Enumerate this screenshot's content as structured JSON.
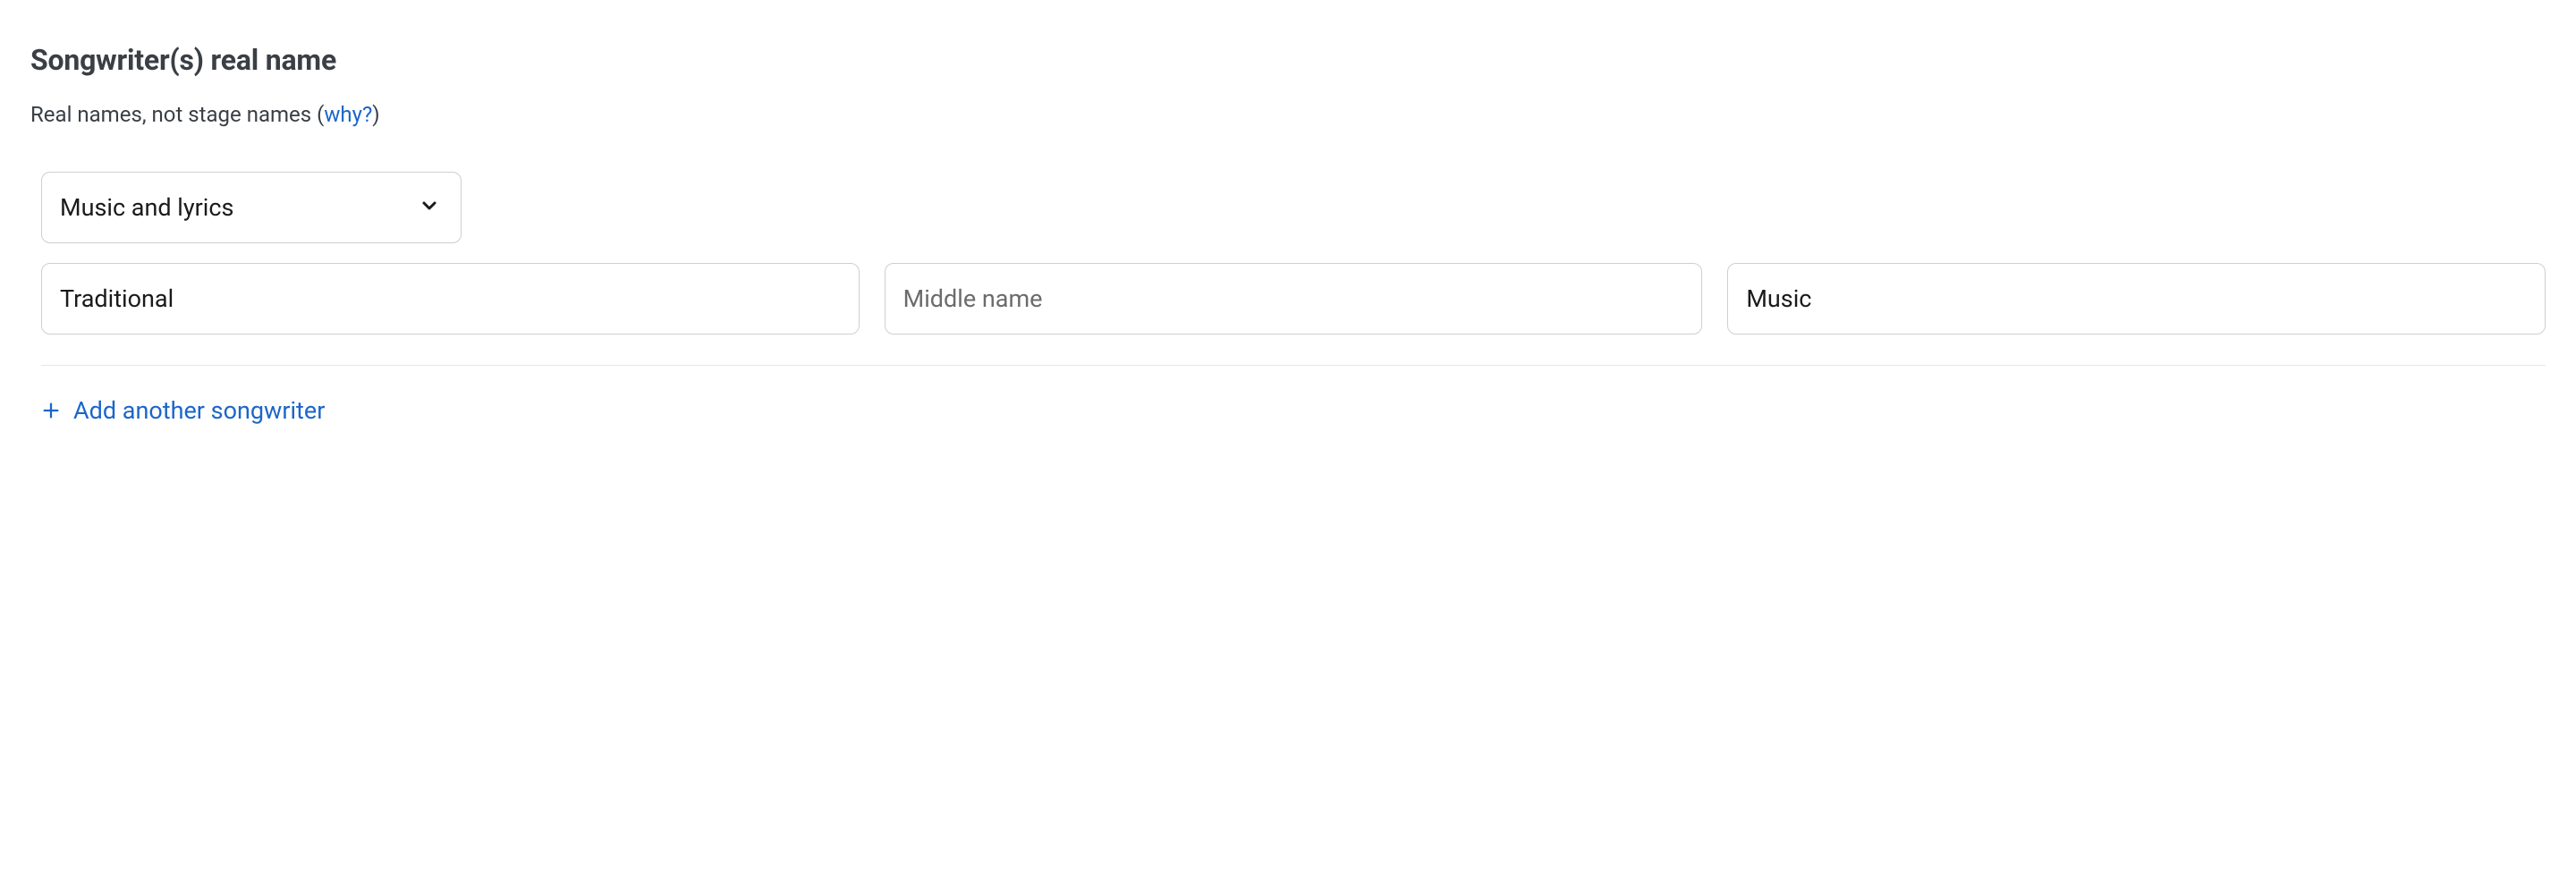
{
  "section": {
    "title": "Songwriter(s) real name",
    "helper_prefix": "Real names, not stage names (",
    "helper_link": "why?",
    "helper_suffix": ")"
  },
  "songwriter": {
    "role_select_value": "Music and lyrics",
    "first_name_value": "Traditional",
    "middle_name_placeholder": "Middle name",
    "middle_name_value": "",
    "last_name_value": "Music"
  },
  "actions": {
    "add_songwriter_label": "Add another songwriter"
  }
}
